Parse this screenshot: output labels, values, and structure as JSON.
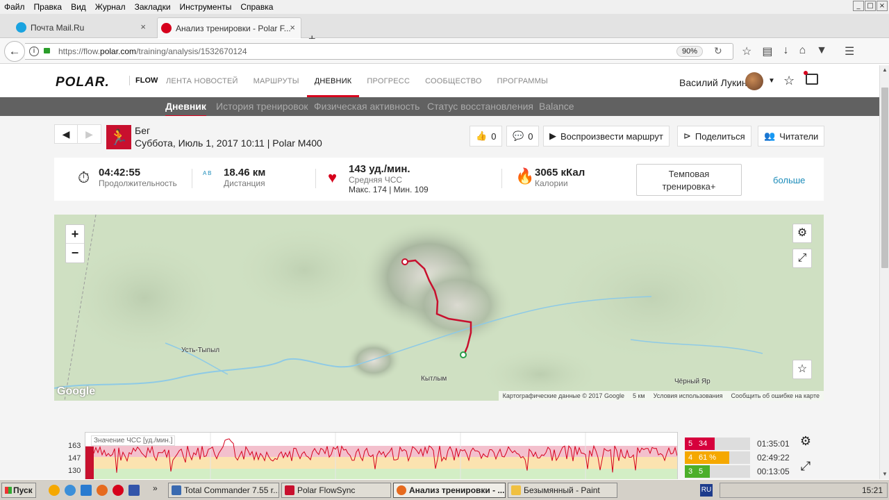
{
  "browser": {
    "menu": [
      "Файл",
      "Правка",
      "Вид",
      "Журнал",
      "Закладки",
      "Инструменты",
      "Справка"
    ],
    "window_controls": [
      "_",
      "□",
      "×"
    ],
    "tabs": [
      {
        "title": "Почта Mail.Ru",
        "close": "×"
      },
      {
        "title": "Анализ тренировки - Polar F...",
        "close": "×"
      }
    ],
    "new_tab": "+",
    "url_prefix": "https://flow.",
    "url_domain": "polar.com",
    "url_path": "/training/analysis/1532670124",
    "zoom": "90%"
  },
  "polar": {
    "logo": "POLAR.",
    "product": "FLOW",
    "nav": [
      "ЛЕНТА НОВОСТЕЙ",
      "МАРШРУТЫ",
      "ДНЕВНИК",
      "ПРОГРЕСС",
      "СООБЩЕСТВО",
      "ПРОГРАММЫ"
    ],
    "nav_active_index": 2,
    "user": "Василий Лукин",
    "subnav": [
      "Дневник",
      "История тренировок",
      "Физическая активность",
      "Статус восстановления",
      "Balance"
    ],
    "subnav_active_index": 0
  },
  "session": {
    "sport": "Бег",
    "meta": "Суббота, Июль 1, 2017 10:11 | Polar M400",
    "likes": "0",
    "comments": "0",
    "replay": "Воспроизвести маршрут",
    "share": "Поделиться",
    "readers": "Читатели"
  },
  "summary": {
    "duration_value": "04:42:55",
    "duration_label": "Продолжительность",
    "distance_icon_text": "A  B",
    "distance_value": "18.46 км",
    "distance_label": "Дистанция",
    "hr_value": "143 уд./мин.",
    "hr_label": "Средняя ЧСС",
    "hr_minmax": "Макс. 174  |  Мин. 109",
    "calories_value": "3065 кКал",
    "calories_label": "Калории",
    "benefit_line1": "Темповая",
    "benefit_line2": "тренировка+",
    "more": "больше"
  },
  "map": {
    "zoom_in": "+",
    "zoom_out": "−",
    "places": [
      "Усть-Тыпыл",
      "Кытлым",
      "Чёрный Яр"
    ],
    "google": "Google",
    "attribution": [
      "Картографические данные © 2017 Google",
      "5 км",
      "Условия использования",
      "Сообщить об ошибке на карте"
    ]
  },
  "hr_chart": {
    "title": "Значение ЧСС [уд./мин.]",
    "y_ticks": [
      "163",
      "147",
      "130"
    ],
    "zones": [
      {
        "zone": "5",
        "percent": "34 %",
        "fraction": 0.34,
        "time": "01:35:01",
        "color": "#d6003c"
      },
      {
        "zone": "4",
        "percent": "61 %",
        "fraction": 0.61,
        "time": "02:49:22",
        "color": "#f5a800"
      },
      {
        "zone": "3",
        "percent": "5 %",
        "fraction": 0.05,
        "time": "00:13:05",
        "color": "#4caf2a"
      }
    ]
  },
  "taskbar": {
    "start": "Пуск",
    "tasks": [
      "Total Commander 7.55 r...",
      "Polar FlowSync",
      "Анализ тренировки - ...",
      "Безымянный - Paint"
    ],
    "active_task_index": 2,
    "lang": "RU",
    "clock": "15:21"
  },
  "colors": {
    "accent": "#d6001c",
    "link": "#1a8bb9",
    "subnav_bg": "#616161"
  }
}
